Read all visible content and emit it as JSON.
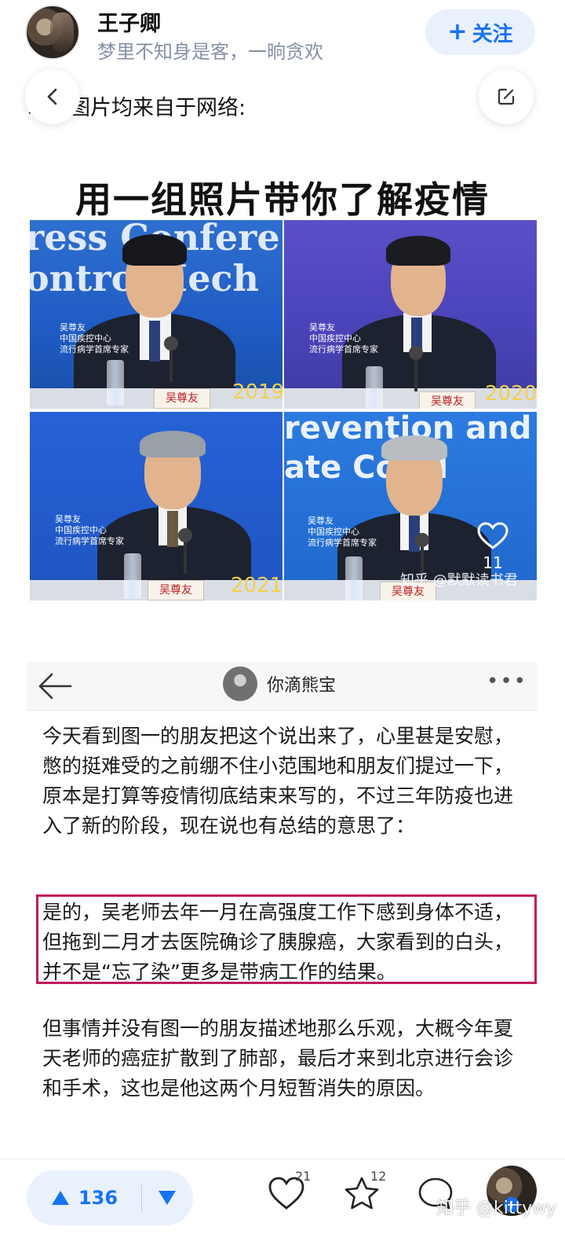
{
  "header": {
    "author_name": "王子卿",
    "author_signature": "梦里不知身是客，一晌贪欢",
    "follow_label": "关注",
    "follow_plus": "+"
  },
  "post": {
    "intro_text": "以下图片均来自于网络:",
    "figure_title": "用一组照片带你了解疫情",
    "photos": [
      {
        "bg_text": "ress Confere\nontro Mech",
        "caption": "吴尊友\n中国疾控中心\n流行病学首席专家",
        "nameplate": "吴尊友",
        "year": "2019"
      },
      {
        "bg_text": "",
        "caption": "吴尊友\n中国疾控中心\n流行病学首席专家",
        "nameplate": "吴尊友",
        "year": "2020"
      },
      {
        "bg_text": "",
        "caption": "吴尊友\n中国疾控中心\n流行病学首席专家",
        "nameplate": "吴尊友",
        "year": "2021"
      },
      {
        "bg_text": "revention and\nate Co cil",
        "caption": "吴尊友\n中国疾控中心\n流行病学首席专家",
        "nameplate": "吴尊友",
        "year": ""
      }
    ],
    "image_like_count": "11",
    "image_watermark": "知乎 @默默读书君"
  },
  "screenshot": {
    "username": "你滴熊宝",
    "more_label": "•••",
    "para1": "今天看到图一的朋友把这个说出来了，心里甚是安慰，憋的挺难受的之前绷不住小范围地和朋友们提过一下，原本是打算等疫情彻底结束来写的，不过三年防疫也进入了新的阶段，现在说也有总结的意思了：",
    "para2": "是的，吴老师去年一月在高强度工作下感到身体不适，但拖到二月才去医院确诊了胰腺癌，大家看到的白头，并不是“忘了染”更多是带病工作的结果。",
    "para3": "但事情并没有图一的朋友描述地那么乐观，大概今年夏天老师的癌症扩散到了肺部，最后才来到北京进行会诊和手术，这也是他这两个月短暂消失的原因。"
  },
  "bottom_bar": {
    "upvote_count": "136",
    "like_count": "21",
    "favorite_count": "12",
    "watermark": "知乎 @kittywy"
  },
  "colors": {
    "accent": "#1772f6",
    "highlight_border": "#c2185b",
    "year_text": "#f2d04b"
  }
}
